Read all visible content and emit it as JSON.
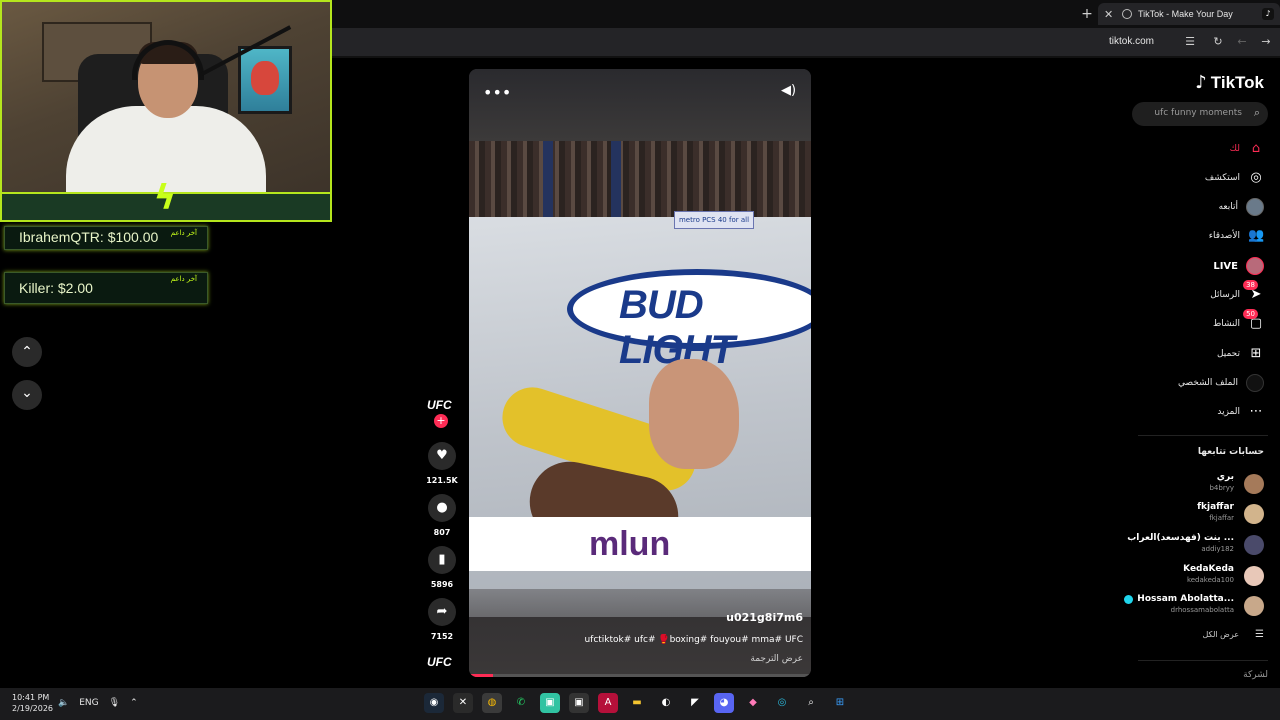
{
  "browser": {
    "new_tab_icon": "+",
    "tab_title": "TikTok - Make Your Day",
    "tab_close_icon": "✕",
    "url": "tiktok.com"
  },
  "overlay": {
    "donations": [
      {
        "amount": "IbrahemQTR: $100.00",
        "tag": "آخر داعم"
      },
      {
        "amount": "Killer: $2.00",
        "tag": "آخر داعم"
      }
    ]
  },
  "video": {
    "username": "u021g8i7m6",
    "caption": "ufctiktok# ufc# 🥊boxing# fouyou# mma# UFC",
    "translate": "عرض الترجمة",
    "progress": 0.07,
    "mat_logo": "BUD LIGHT",
    "sign_text": "metro PCS 40 for all",
    "band_text": "mlun"
  },
  "actions": {
    "creator": "UFC",
    "likes": "121.5K",
    "comments": "807",
    "saves": "5896",
    "shares": "7152",
    "bottom_logo": "UFC"
  },
  "sidebar": {
    "logo": "TikTok",
    "search_placeholder": "ufc funny moments",
    "nav": [
      {
        "label": "لك",
        "icon": "home-icon"
      },
      {
        "label": "استكشف",
        "icon": "compass-icon"
      },
      {
        "label": "أتابعه",
        "icon": "following-avatar"
      },
      {
        "label": "الأصدقاء",
        "icon": "friends-icon"
      },
      {
        "label": "LIVE",
        "icon": "live-avatar"
      },
      {
        "label": "الرسائل",
        "icon": "messages-icon",
        "badge": "38"
      },
      {
        "label": "النشاط",
        "icon": "activity-icon",
        "badge": "50"
      },
      {
        "label": "تحميل",
        "icon": "upload-icon"
      },
      {
        "label": "الملف الشخصي",
        "icon": "profile-avatar"
      },
      {
        "label": "المزيد",
        "icon": "more-icon"
      }
    ],
    "following_title": "حسابات تتابعها",
    "accounts": [
      {
        "name": "بري",
        "handle": "b4bryy"
      },
      {
        "name": "fkjaffar",
        "handle": "fkjaffar"
      },
      {
        "name": "بنت (فهدسعد)العراب ...",
        "handle": "addiy182"
      },
      {
        "name": "KedaKeda",
        "handle": "kedakeda100"
      },
      {
        "name": "Hossam Abolatta...",
        "handle": "drhossamabolatta"
      }
    ],
    "see_all": "عرض الكل",
    "company": "لشركة"
  },
  "taskbar": {
    "time": "10:41 PM",
    "date": "2/19/2026",
    "lang": "ENG"
  },
  "colors": {
    "accent": "#fe2c55",
    "overlay_green": "#b5e61d"
  }
}
